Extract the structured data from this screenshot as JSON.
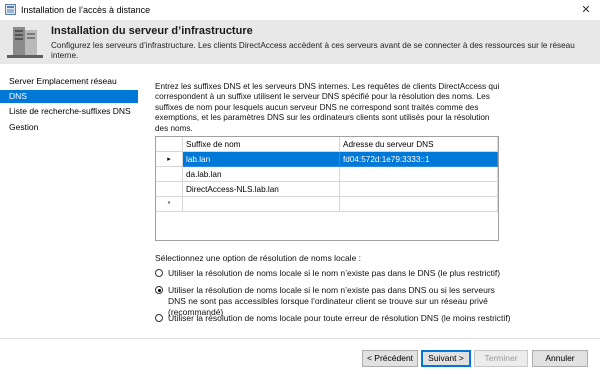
{
  "window": {
    "title": "Installation de l’accès à distance",
    "close_glyph": "✕"
  },
  "header": {
    "title": "Installation du serveur d’infrastructure",
    "description": "Configurez les serveurs d’infrastructure. Les clients DirectAccess accèdent à ces serveurs avant de se connecter à des ressources sur le réseau interne."
  },
  "sidebar": {
    "items": [
      {
        "label": "Server Emplacement réseau",
        "selected": false
      },
      {
        "label": "DNS",
        "selected": true
      },
      {
        "label": "Liste de recherche-suffixes DNS",
        "selected": false
      },
      {
        "label": "Gestion",
        "selected": false
      }
    ]
  },
  "main": {
    "intro": "Entrez les suffixes DNS et les serveurs DNS internes. Les requêtes de clients DirectAccess qui correspondent à un suffixe utilisent le serveur DNS spécifié pour la résolution des noms. Les suffixes de nom pour lesquels aucun serveur DNS ne correspond sont traités comme des exemptions, et les paramètres DNS sur les ordinateurs clients sont utilisés pour la résolution des noms.",
    "table": {
      "columns": [
        "Suffixe de nom",
        "Adresse du serveur DNS"
      ],
      "rows": [
        {
          "marker": "▸",
          "suffix": "lab.lan",
          "server": "fd04:572d:1e79:3333::1",
          "selected": true
        },
        {
          "marker": "",
          "suffix": "da.lab.lan",
          "server": "",
          "selected": false
        },
        {
          "marker": "",
          "suffix": "DirectAccess-NLS.lab.lan",
          "server": "",
          "selected": false
        },
        {
          "marker": "*",
          "suffix": "",
          "server": "",
          "selected": false
        }
      ]
    },
    "resolution_prompt": "Sélectionnez une option de résolution de noms locale :",
    "options": [
      {
        "label": "Utiliser la résolution de noms locale si le nom n’existe pas dans le DNS (le plus restrictif)",
        "checked": false
      },
      {
        "label": "Utiliser la résolution de noms locale si le nom n’existe pas dans DNS ou si les serveurs DNS ne sont pas accessibles lorsque l’ordinateur client se trouve sur un réseau privé (recommandé)",
        "checked": true
      },
      {
        "label": "Utiliser la résolution de noms locale pour toute erreur de résolution DNS (le moins restrictif)",
        "checked": false
      }
    ]
  },
  "footer": {
    "previous": "< Précédent",
    "next": "Suivant >",
    "finish": "Terminer",
    "cancel": "Annuler"
  },
  "colors": {
    "accent": "#0078d7",
    "header_bg": "#e8e8e8"
  }
}
